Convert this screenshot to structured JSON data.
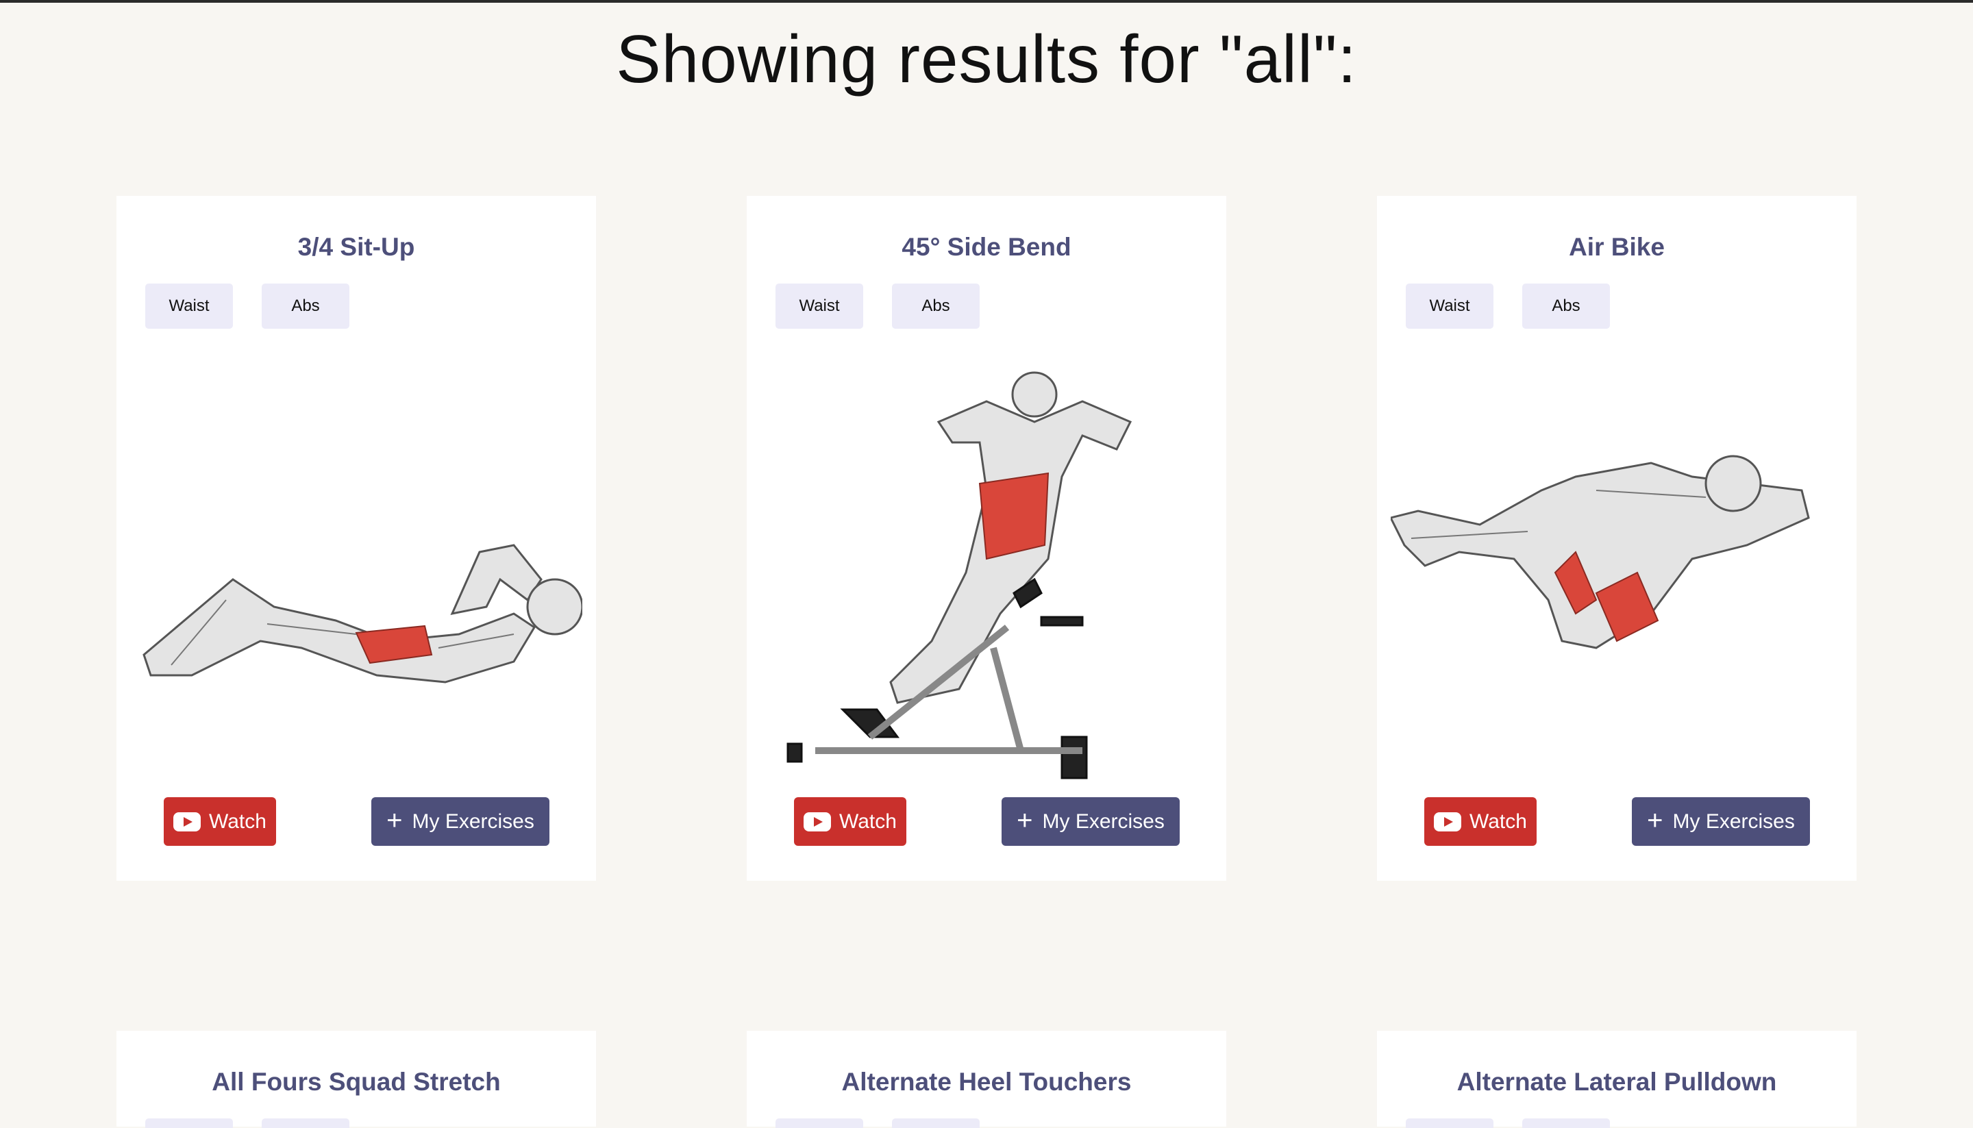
{
  "heading": "Showing results for \"all\":",
  "buttons": {
    "watch": "Watch",
    "my_exercises": "My Exercises"
  },
  "colors": {
    "background": "#f8f6f2",
    "card": "#ffffff",
    "title": "#4d4f7a",
    "tag_bg": "#ecebf8",
    "watch_bg": "#c9302c",
    "my_exercises_bg": "#4d4f7a",
    "muscle_highlight": "#d9463a"
  },
  "icons": {
    "watch": "youtube-icon",
    "add": "plus-icon"
  },
  "exercises": [
    {
      "name": "3/4 Sit-Up",
      "tags": [
        "Waist",
        "Abs"
      ],
      "image": "sit-up-illustration"
    },
    {
      "name": "45° Side Bend",
      "tags": [
        "Waist",
        "Abs"
      ],
      "image": "side-bend-illustration"
    },
    {
      "name": "Air Bike",
      "tags": [
        "Waist",
        "Abs"
      ],
      "image": "air-bike-illustration"
    },
    {
      "name": "All Fours Squad Stretch"
    },
    {
      "name": "Alternate Heel Touchers"
    },
    {
      "name": "Alternate Lateral Pulldown"
    }
  ]
}
